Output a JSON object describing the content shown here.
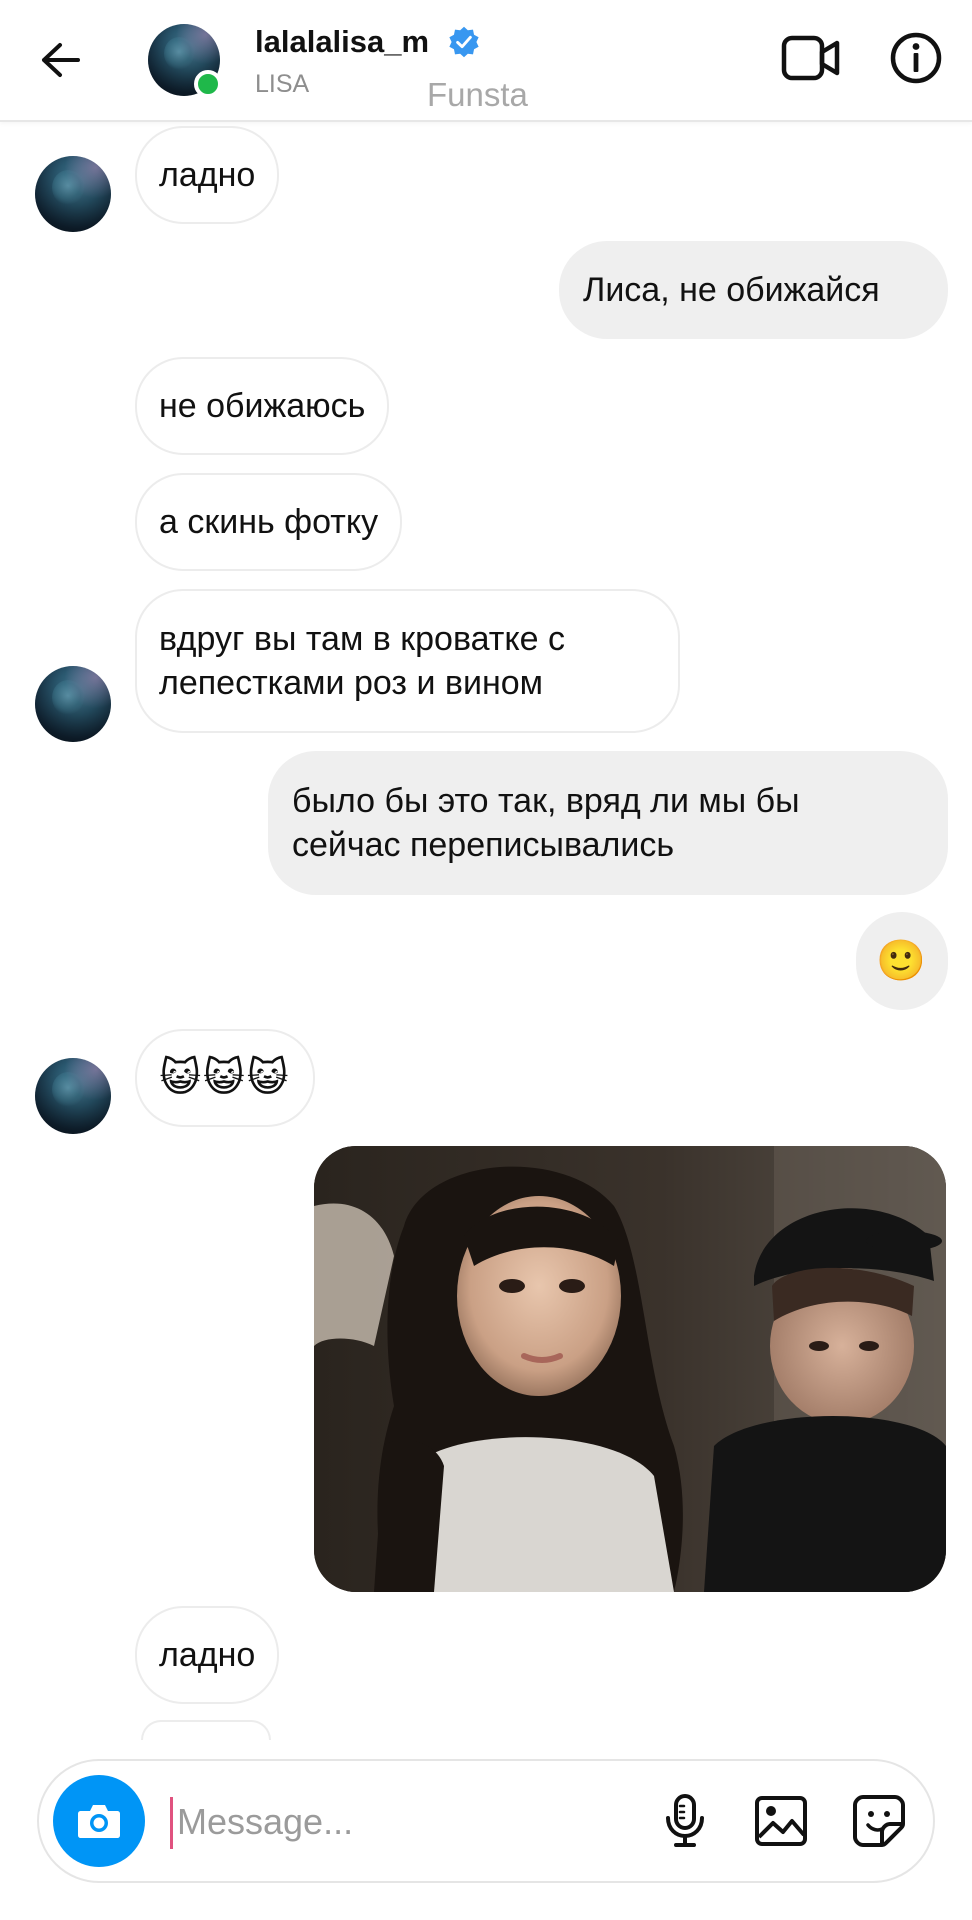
{
  "header": {
    "back_icon": "arrow-left-icon",
    "username": "lalalalisa_m",
    "verified_icon": "verified-badge-icon",
    "subname": "LISA",
    "overlay_text": "Funsta",
    "video_icon": "video-camera-icon",
    "info_icon": "info-icon",
    "online_color": "#1fb84a"
  },
  "messages": [
    {
      "sender": "them",
      "text": "ладно"
    },
    {
      "sender": "me",
      "text": "Лиса, не обижайся"
    },
    {
      "sender": "them",
      "text": "не обижаюсь"
    },
    {
      "sender": "them",
      "text": "а скинь фотку"
    },
    {
      "sender": "them",
      "lines": [
        "вдруг вы там в кроватке с",
        "лепестками роз и вином"
      ]
    },
    {
      "sender": "me",
      "lines": [
        "было бы это так, вряд ли мы бы",
        "сейчас переписывались"
      ]
    },
    {
      "sender": "me",
      "text": "🙂"
    },
    {
      "sender": "them",
      "text": "😺😺😺"
    },
    {
      "sender": "me",
      "type": "photo",
      "description_icon": "shared-photo"
    },
    {
      "sender": "them",
      "text": "ладно"
    }
  ],
  "composer": {
    "placeholder": "Message...",
    "camera_icon": "camera-icon",
    "mic_icon": "microphone-icon",
    "gallery_icon": "gallery-icon",
    "sticker_icon": "sticker-icon",
    "accent_color": "#0095f6"
  }
}
